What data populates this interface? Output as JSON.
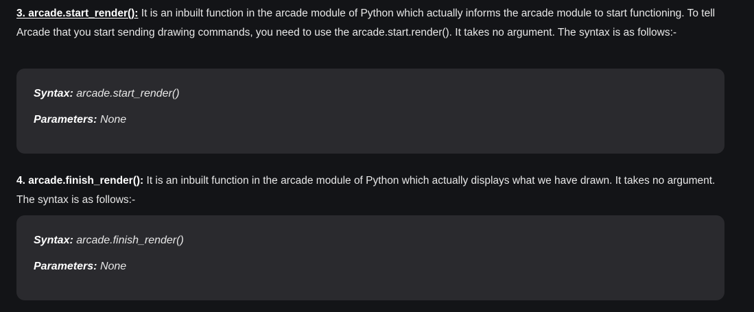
{
  "section3": {
    "heading": "3. arcade.start_render():",
    "text": " It is an inbuilt function in the arcade module of Python which actually informs the arcade module to start functioning. To tell Arcade that you start sending drawing commands, you need to use the arcade.start.render(). It takes no argument. The syntax is as follows:-",
    "syntax_label": "Syntax:",
    "syntax_value": " arcade.start_render()",
    "params_label": "Parameters:",
    "params_value": " None"
  },
  "section4": {
    "heading": "4. arcade.finish_render():",
    "text": " It is an inbuilt function in the arcade module of Python which actually displays what we have drawn. It takes no argument. The syntax is as follows:-",
    "syntax_label": "Syntax:",
    "syntax_value": " arcade.finish_render()",
    "params_label": "Parameters:",
    "params_value": " None"
  }
}
